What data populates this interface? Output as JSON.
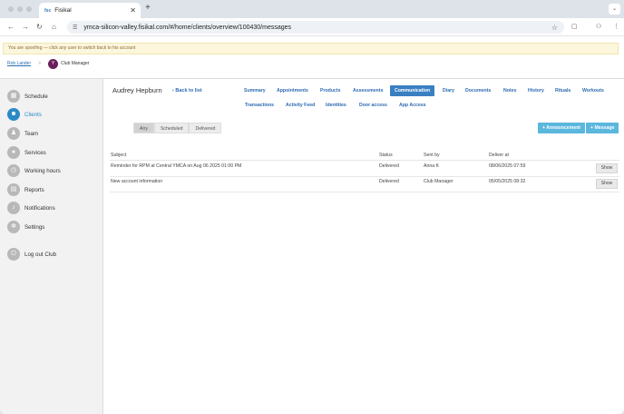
{
  "browser": {
    "tab_title": "Fisikal",
    "tab_favicon": "fsc",
    "url": "ymca-silicon-valley.fisikal.com/#/home/clients/overview/100430/messages"
  },
  "spoof_banner": "You are spoofing — click any user to switch back to his account",
  "breadcrumb": {
    "user": "Rob Lander",
    "separator": ">",
    "club_logo": "Y",
    "club": "Club Manager"
  },
  "sidebar": {
    "items": [
      {
        "label": "Schedule",
        "icon": "calendar-icon"
      },
      {
        "label": "Clients",
        "icon": "users-icon"
      },
      {
        "label": "Team",
        "icon": "person-icon"
      },
      {
        "label": "Services",
        "icon": "services-icon"
      },
      {
        "label": "Working hours",
        "icon": "clock-icon"
      },
      {
        "label": "Reports",
        "icon": "reports-icon"
      },
      {
        "label": "Notifications",
        "icon": "bell-icon"
      },
      {
        "label": "Settings",
        "icon": "gear-icon"
      },
      {
        "label": "Log out Club",
        "icon": "logout-icon"
      }
    ],
    "active": "Clients"
  },
  "client": {
    "name": "Audrey Hepburn",
    "back_label": "Back to list"
  },
  "tabs": [
    "Summary",
    "Appointments",
    "Products",
    "Assessments",
    "Communication",
    "Diary",
    "Documents",
    "Notes",
    "History",
    "Rituals",
    "Workouts",
    "Transactions",
    "Activity Feed",
    "Identities",
    "Door access",
    "App Access"
  ],
  "active_tab": "Communication",
  "filters": [
    "Any",
    "Scheduled",
    "Delivered"
  ],
  "active_filter": "Any",
  "actions": {
    "announcement": "+ Announcement",
    "message": "+ Message"
  },
  "table": {
    "headers": [
      "Subject",
      "Status",
      "Sent by",
      "Deliver at"
    ],
    "rows": [
      {
        "subject": "Reminder for RPM at Central YMCA on Aug 06 2025 01:00 PM",
        "status": "Delivered",
        "sent_by": "Anna K",
        "deliver_at": "08/06/2025 07:59",
        "action": "Show"
      },
      {
        "subject": "New account information",
        "status": "Delivered",
        "sent_by": "Club Manager",
        "deliver_at": "05/05/2025 08:32",
        "action": "Show"
      }
    ]
  },
  "colors": {
    "accent": "#2b8ac6",
    "active_tab": "#3a7fc1",
    "action_button": "#5bb7dd",
    "banner_bg": "#fcf6dc"
  }
}
